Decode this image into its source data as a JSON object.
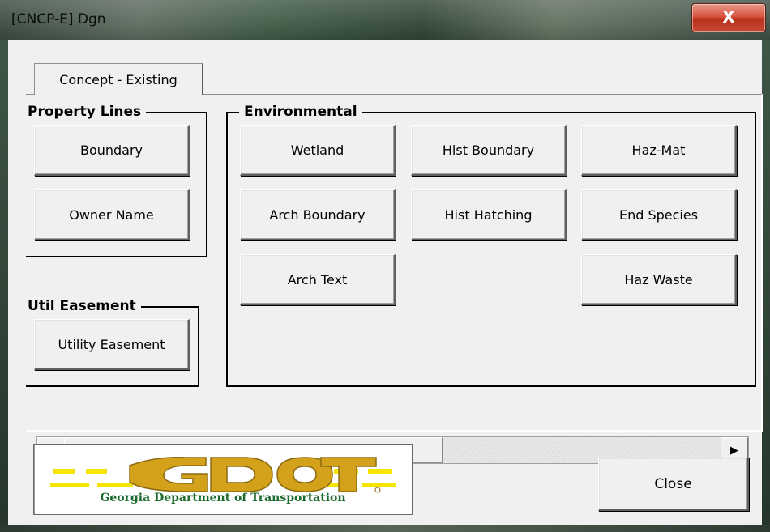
{
  "window": {
    "title": "[CNCP-E] Dgn",
    "close_glyph": "X"
  },
  "tabs": [
    {
      "label": "Concept - Existing",
      "selected": true
    }
  ],
  "property_lines": {
    "label": "Property Lines",
    "buttons": [
      "Boundary",
      "Owner Name"
    ]
  },
  "util_easement": {
    "label": "Util Easement",
    "buttons": [
      "Utility Easement"
    ]
  },
  "environmental": {
    "label": "Environmental",
    "buttons": {
      "wetland": "Wetland",
      "hist_boundary": "Hist Boundary",
      "haz_mat": "Haz-Mat",
      "arch_boundary": "Arch Boundary",
      "hist_hatching": "Hist Hatching",
      "end_species": "End Species",
      "arch_text": "Arch Text",
      "haz_waste": "Haz Waste"
    }
  },
  "scrollbar": {
    "left_arrow": "◀",
    "right_arrow": "▶"
  },
  "logo": {
    "wordmark": "GDOT",
    "subtitle": "Georgia Department of Transportation",
    "colors": {
      "gold": "#d4a21a",
      "yellow": "#f5e400",
      "green": "#1d6b2e"
    }
  },
  "footer": {
    "close_label": "Close"
  }
}
